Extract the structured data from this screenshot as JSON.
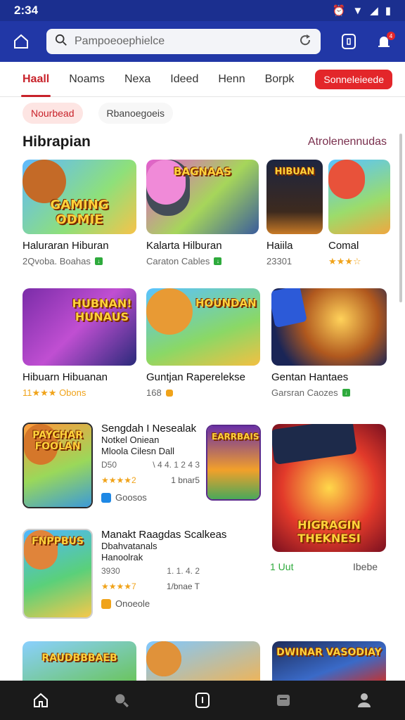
{
  "status": {
    "time": "2:34"
  },
  "search": {
    "placeholder": "Pampoeoephielce"
  },
  "tabs": [
    "Haall",
    "Noams",
    "Nexa",
    "Ideed",
    "Henn",
    "Borpk"
  ],
  "tab_cta": "Sonneleieede",
  "chips": [
    "Nourbead",
    "Rbanoegoeis"
  ],
  "section": {
    "title": "Hibrapian",
    "link": "Atrolenennudas"
  },
  "row1": [
    {
      "name": "Haluraran Hiburan",
      "meta": "2Qvoba. Boahas",
      "art": "GAMING ODMIE"
    },
    {
      "name": "Kalarta Hilburan",
      "meta": "Caraton Cables",
      "art": "BAGNAAS"
    },
    {
      "name": "Haiila",
      "meta": "23301",
      "art": "HIBUAN"
    },
    {
      "name": "Comal",
      "meta": "★★★☆",
      "art": ""
    }
  ],
  "row2": [
    {
      "name": "Hibuarn Hibuanan",
      "meta": "11★★★ Obons",
      "art": "HUBNAN! HUNAUS"
    },
    {
      "name": "Guntjan Raperelekse",
      "meta": "168",
      "art": "HOUNDAN"
    },
    {
      "name": "Gentan Hantaes",
      "meta": "Garsran Caozes",
      "art": ""
    }
  ],
  "list1": {
    "title": "Sengdah I Nesealak",
    "sub1": "Notkel Oniean",
    "sub2": "Mloola Cilesn Dall",
    "meta_left": "D50",
    "meta_right": "\\ 4 4. 1 2 4 3",
    "rating": "★★★★2",
    "count": "1 bnar5",
    "tag": "Goosos",
    "art": "PAYCHAR FOOLAN"
  },
  "list2": {
    "title": "Manakt Raagdas Scalkeas",
    "sub1": "Dbahvatanals",
    "sub2": "Hanoolrak",
    "meta_left": "3930",
    "meta_right": "1. 1. 4. 2",
    "rating": "★★★★7",
    "count": "1/bnae T",
    "tag": "Onoeole",
    "art": "FNPPBUS"
  },
  "mid_thumb": {
    "art": "EARRBAIS"
  },
  "promo": {
    "art": "HIGRAGIN THEKNESI",
    "left": "1 Uut",
    "right": "Ibebe"
  },
  "row3": [
    {
      "art": "RAUDBBBAEB"
    },
    {
      "art": ""
    },
    {
      "art": "DWINAR VASODIAY"
    }
  ],
  "colors": {
    "appbar": "#2137a6",
    "accent": "#e3262a",
    "statusbar": "#1b2f8f"
  }
}
